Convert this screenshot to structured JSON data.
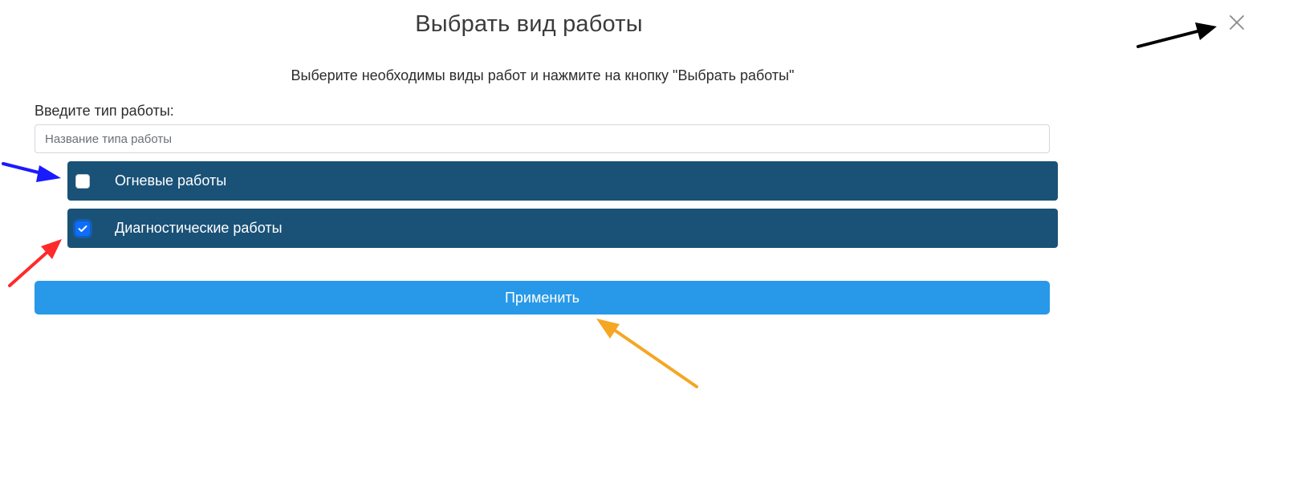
{
  "dialog": {
    "title": "Выбрать вид работы",
    "instruction": "Выберите необходимы виды работ и нажмите на кнопку \"Выбрать работы\"",
    "close_icon": "close-icon"
  },
  "search": {
    "label": "Введите тип работы:",
    "placeholder": "Название типа работы",
    "value": ""
  },
  "work_types": [
    {
      "label": "Огневые работы",
      "checked": false
    },
    {
      "label": "Диагностические работы",
      "checked": true
    }
  ],
  "apply_button": {
    "label": "Применить"
  },
  "colors": {
    "item_background": "#1a5177",
    "apply_button": "#2899e8",
    "checkbox_checked": "#0d6efd",
    "annotation_arrows": [
      "#000000",
      "#1a1aff",
      "#ff2a2a",
      "#f5a623"
    ]
  }
}
